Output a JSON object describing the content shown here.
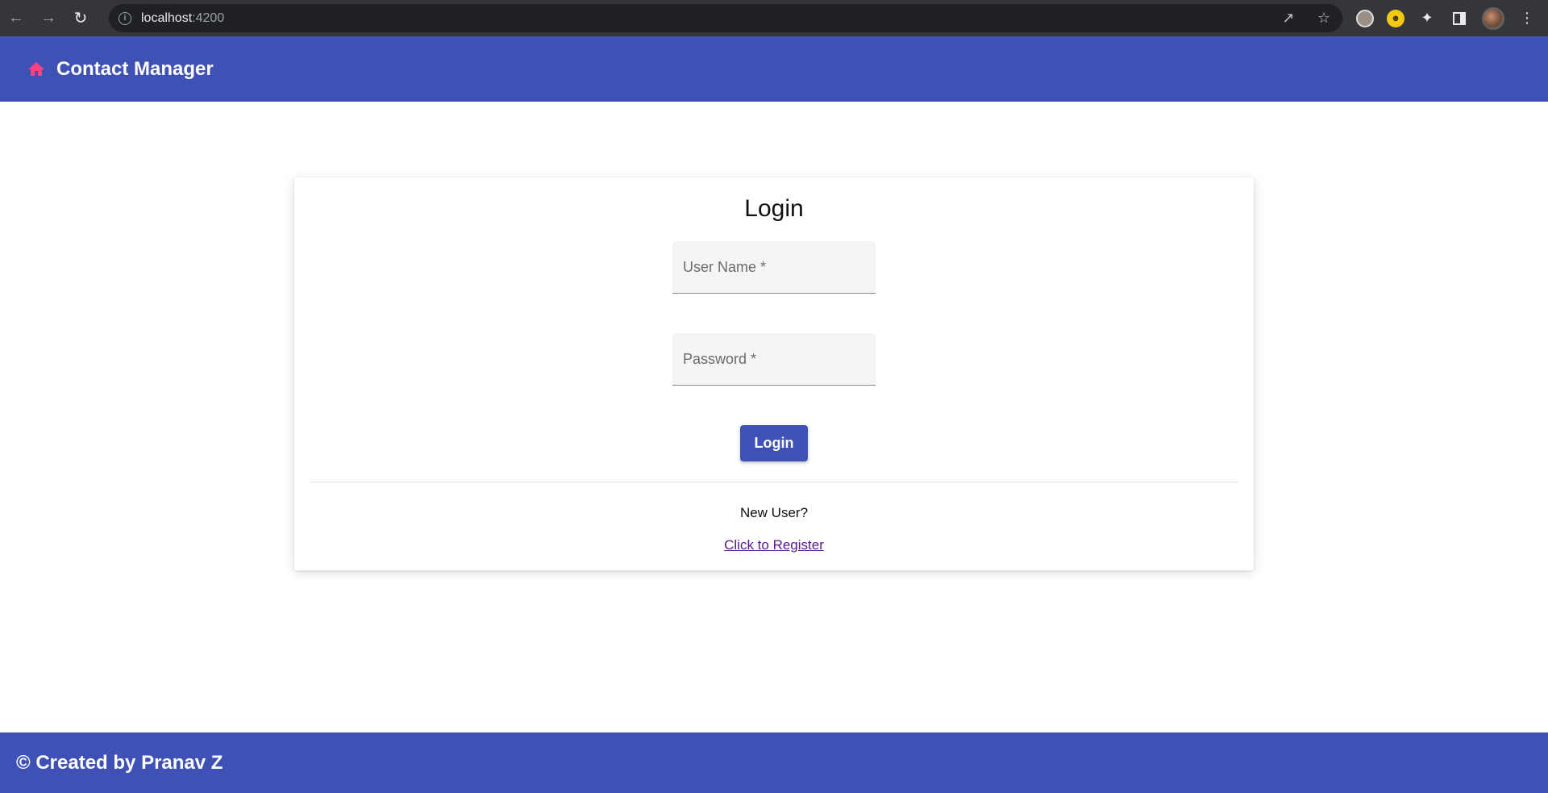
{
  "browser": {
    "url_host": "localhost",
    "url_port": ":4200",
    "back_icon": "arrow-left",
    "forward_icon": "arrow-right",
    "reload_icon": "reload"
  },
  "toolbar": {
    "title": "Contact Manager",
    "icon": "home-icon",
    "icon_color": "#ff4081"
  },
  "login": {
    "title": "Login",
    "username_placeholder": "User Name *",
    "password_placeholder": "Password *",
    "button_label": "Login",
    "new_user_text": "New User?",
    "register_link": "Click to Register"
  },
  "footer": {
    "text": "© Created by Pranav Z"
  },
  "colors": {
    "primary": "#3f51b5",
    "accent": "#ff4081"
  }
}
